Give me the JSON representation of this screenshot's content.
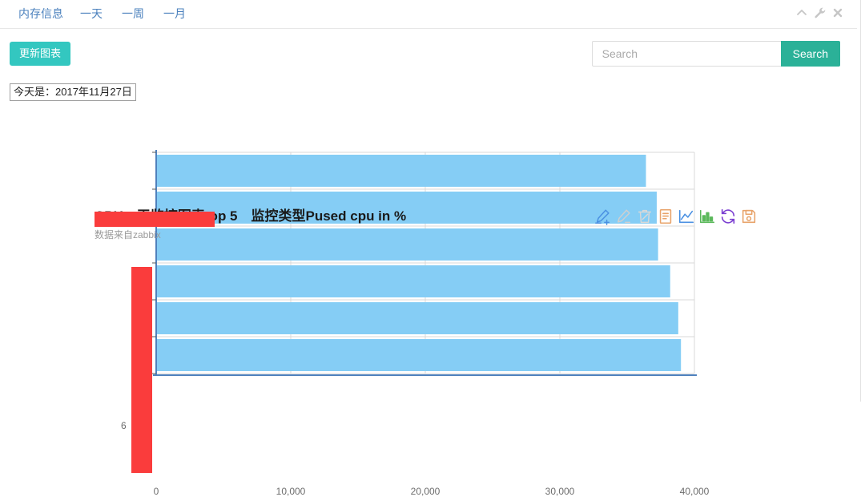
{
  "window": {
    "nav": [
      {
        "name": "nav-memory",
        "label": "内存信息"
      },
      {
        "name": "nav-day",
        "label": "一天"
      },
      {
        "name": "nav-week",
        "label": "一周"
      },
      {
        "name": "nav-month",
        "label": "一月"
      }
    ],
    "controls": [
      {
        "name": "collapse-icon",
        "icon": "chevron-up-icon"
      },
      {
        "name": "wrench-icon",
        "icon": "wrench-icon"
      },
      {
        "name": "close-icon",
        "icon": "close-icon"
      }
    ]
  },
  "toolbar": {
    "refresh_chart_label": "更新图表",
    "refresh_chart_color": "#33c7c0"
  },
  "search": {
    "placeholder": "Search",
    "value": "",
    "button_label": "Search",
    "button_color": "#2bb198"
  },
  "date_badge": {
    "text": "今天是：2017年11月27日"
  },
  "chart_actions": [
    {
      "name": "add-annotation-icon",
      "icon": "pencil-plus-icon",
      "color": "#4a90e2",
      "enabled": true
    },
    {
      "name": "edit-annotation-icon",
      "icon": "pencil-minus-icon",
      "color": "#cfcfcf",
      "enabled": false
    },
    {
      "name": "delete-icon",
      "icon": "trash-icon",
      "color": "#d8d8d8",
      "enabled": false
    },
    {
      "name": "data-table-icon",
      "icon": "document-icon",
      "color": "#e8a36a",
      "enabled": true
    },
    {
      "name": "line-chart-icon",
      "icon": "line-chart-icon",
      "color": "#4a90e2",
      "enabled": true
    },
    {
      "name": "bar-chart-icon",
      "icon": "bar-chart-icon",
      "color": "#5ab85a",
      "enabled": true
    },
    {
      "name": "refresh-icon",
      "icon": "refresh-icon",
      "color": "#7b3fd1",
      "enabled": true
    },
    {
      "name": "save-icon",
      "icon": "floppy-disk-icon",
      "color": "#e8a36a",
      "enabled": true
    }
  ],
  "chart_data": {
    "type": "bar",
    "orientation": "horizontal",
    "title": "CPU一天监控图表top 5　监控类型Pused cpu in %",
    "title_redacted_prefix": true,
    "subtitle": "数据来自zabbix",
    "xlabel": "",
    "ylabel": "",
    "categories": [
      "",
      "",
      "",
      "",
      "",
      ""
    ],
    "categories_redacted": true,
    "category_ghost_label": "6",
    "values": [
      36400,
      37200,
      37300,
      38200,
      38800,
      39000
    ],
    "xlim": [
      0,
      40000
    ],
    "xticks": [
      0,
      10000,
      20000,
      30000,
      40000
    ],
    "xtick_labels": [
      "0",
      "10,000",
      "20,000",
      "30,000",
      "40,000"
    ],
    "grid": true,
    "legend": false,
    "bar_color": "#85cdf5",
    "axis_color": "#4f81bd",
    "grid_color": "#d9d9d9",
    "redaction_color": "#fa3c3c"
  }
}
